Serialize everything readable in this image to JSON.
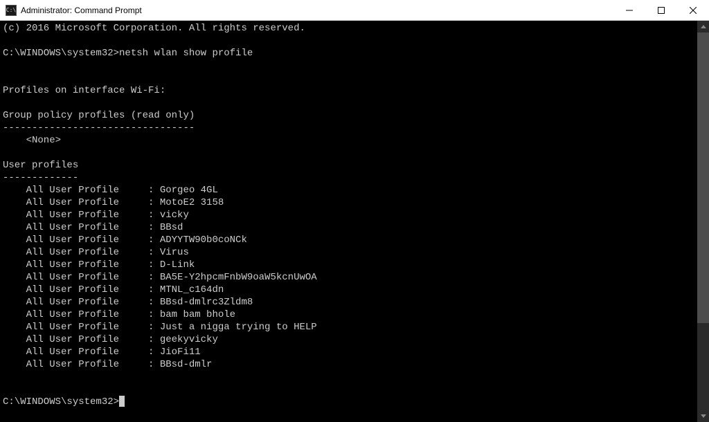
{
  "titlebar": {
    "icon_label": "C:\\",
    "title": "Administrator: Command Prompt"
  },
  "terminal": {
    "copyright": "(c) 2016 Microsoft Corporation. All rights reserved.",
    "prompt1_path": "C:\\WINDOWS\\system32>",
    "prompt1_command": "netsh wlan show profile",
    "interface_header": "Profiles on interface Wi-Fi:",
    "group_policy_header": "Group policy profiles (read only)",
    "group_policy_separator": "---------------------------------",
    "group_policy_none": "    <None>",
    "user_profiles_header": "User profiles",
    "user_profiles_separator": "-------------",
    "profile_label": "    All User Profile     : ",
    "profiles": [
      "Gorgeo 4GL",
      "MotoE2 3158",
      "vicky",
      "BBsd",
      "ADYYTW90b0coNCk",
      "Virus",
      "D-Link",
      "BA5E-Y2hpcmFnbW9oaW5kcnUwOA",
      "MTNL_c164dn",
      "BBsd-dmlrc3Zldm8",
      "bam bam bhole",
      "Just a nigga trying to HELP",
      "geekyvicky",
      "JioFi11",
      "BBsd-dmlr"
    ],
    "prompt2_path": "C:\\WINDOWS\\system32>"
  }
}
